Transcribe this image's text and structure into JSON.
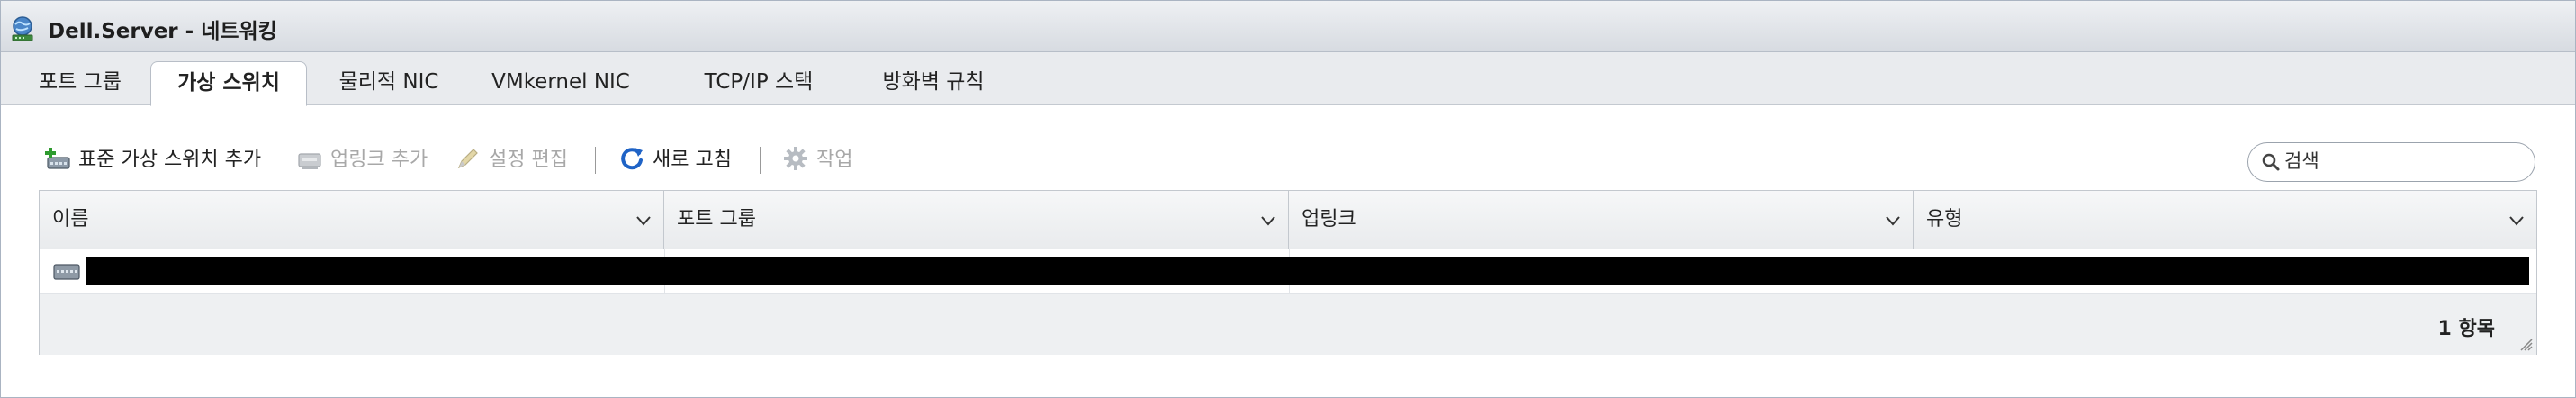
{
  "window": {
    "title": "Dell.Server - 네트워킹",
    "icon": "globe-network-icon"
  },
  "tabs": [
    {
      "label": "포트 그룹",
      "active": false
    },
    {
      "label": "가상 스위치",
      "active": true
    },
    {
      "label": "물리적 NIC",
      "active": false
    },
    {
      "label": "VMkernel NIC",
      "active": false
    },
    {
      "label": "TCP/IP 스택",
      "active": false
    },
    {
      "label": "방화벽 규칙",
      "active": false
    }
  ],
  "toolbar": {
    "add_standard_switch": {
      "label": "표준 가상 스위치 추가",
      "icon": "add-switch-icon",
      "enabled": true
    },
    "add_uplink": {
      "label": "업링크 추가",
      "icon": "add-uplink-icon",
      "enabled": false
    },
    "edit_settings": {
      "label": "설정 편집",
      "icon": "pencil-icon",
      "enabled": false
    },
    "refresh": {
      "label": "새로 고침",
      "icon": "refresh-icon",
      "enabled": true
    },
    "actions": {
      "label": "작업",
      "icon": "gear-icon",
      "enabled": false
    }
  },
  "search": {
    "placeholder": "검색",
    "value": ""
  },
  "grid": {
    "columns": [
      "이름",
      "포트 그룹",
      "업링크",
      "유형"
    ],
    "rows": [
      {
        "icon": "virtual-switch-icon",
        "name": "",
        "port_groups": "",
        "uplinks": "",
        "type": "",
        "redacted": true
      }
    ],
    "footer": {
      "count_label": "1 항목"
    }
  },
  "colors": {
    "accent_refresh": "#1f63c6",
    "disabled_text": "#a8a8a8",
    "titlebar_bg": "#dde0e5"
  }
}
